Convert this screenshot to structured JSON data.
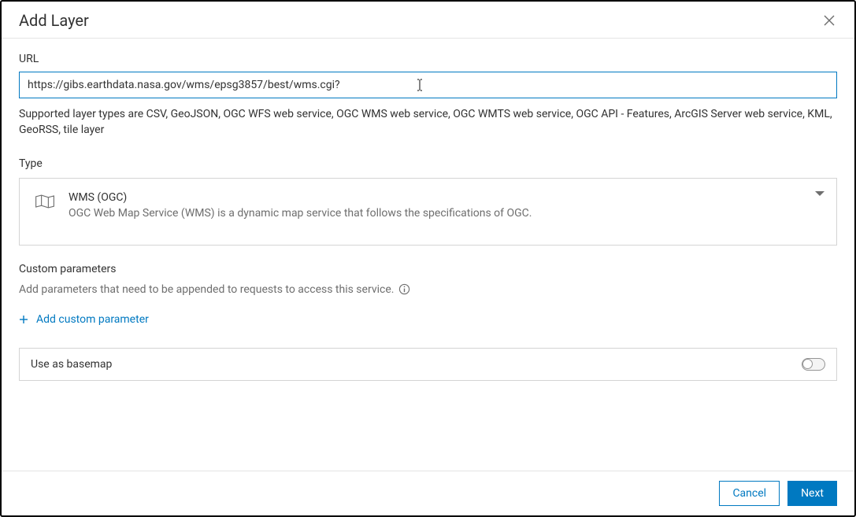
{
  "dialog": {
    "title": "Add Layer"
  },
  "url": {
    "label": "URL",
    "value": "https://gibs.earthdata.nasa.gov/wms/epsg3857/best/wms.cgi?",
    "help": "Supported layer types are CSV, GeoJSON, OGC WFS web service, OGC WMS web service, OGC WMTS web service, OGC API - Features, ArcGIS Server web service, KML, GeoRSS, tile layer"
  },
  "type": {
    "label": "Type",
    "selected": {
      "title": "WMS (OGC)",
      "description": "OGC Web Map Service (WMS) is a dynamic map service that follows the specifications of OGC."
    }
  },
  "customParams": {
    "label": "Custom parameters",
    "description": "Add parameters that need to be appended to requests to access this service.",
    "addButton": "Add custom parameter"
  },
  "basemap": {
    "label": "Use as basemap",
    "enabled": false
  },
  "footer": {
    "cancel": "Cancel",
    "next": "Next"
  }
}
